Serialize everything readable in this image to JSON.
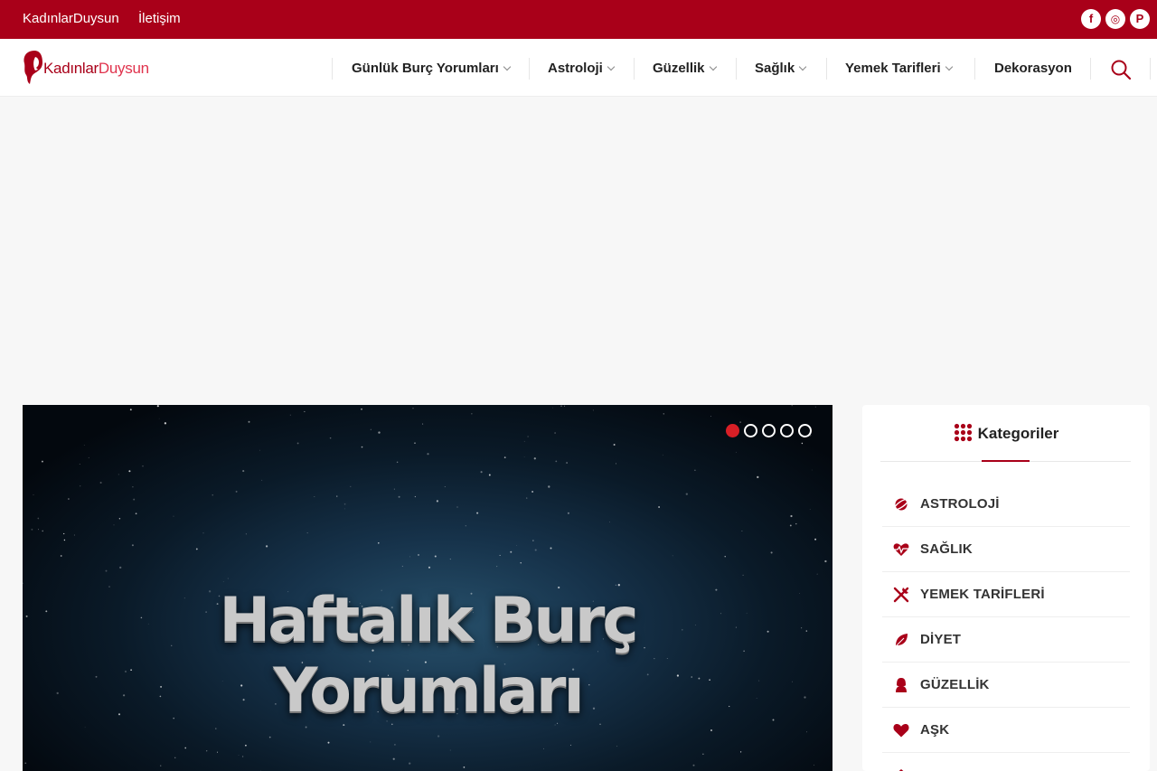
{
  "topbar": {
    "links": [
      "KadınlarDuysun",
      "İletişim"
    ],
    "social": [
      {
        "icon": "facebook-icon",
        "glyph": "f"
      },
      {
        "icon": "instagram-icon",
        "glyph": "◎"
      },
      {
        "icon": "pinterest-icon",
        "glyph": "P"
      }
    ]
  },
  "logo": {
    "part1": "Kadınlar",
    "part2": "Duysun"
  },
  "nav": {
    "items": [
      {
        "label": "Günlük Burç Yorumları",
        "dropdown": true
      },
      {
        "label": "Astroloji",
        "dropdown": true
      },
      {
        "label": "Güzellik",
        "dropdown": true
      },
      {
        "label": "Sağlık",
        "dropdown": true
      },
      {
        "label": "Yemek Tarifleri",
        "dropdown": true
      },
      {
        "label": "Dekorasyon",
        "dropdown": false
      }
    ]
  },
  "slider": {
    "title_line1": "Haftalık Burç",
    "title_line2": "Yorumları",
    "slide_count": 5,
    "active_index": 0
  },
  "sidebar": {
    "title": "Kategoriler",
    "categories": [
      {
        "label": "ASTROLOJİ",
        "icon": "planet-icon"
      },
      {
        "label": "SAĞLIK",
        "icon": "heartbeat-icon"
      },
      {
        "label": "YEMEK TARİFLERİ",
        "icon": "utensils-icon"
      },
      {
        "label": "DİYET",
        "icon": "leaf-icon"
      },
      {
        "label": "GÜZELLİK",
        "icon": "woman-icon"
      },
      {
        "label": "AŞK",
        "icon": "heart-icon"
      }
    ]
  },
  "colors": {
    "brand": "#a90019",
    "accent": "#d81f26",
    "logo_light": "#e0334d"
  }
}
